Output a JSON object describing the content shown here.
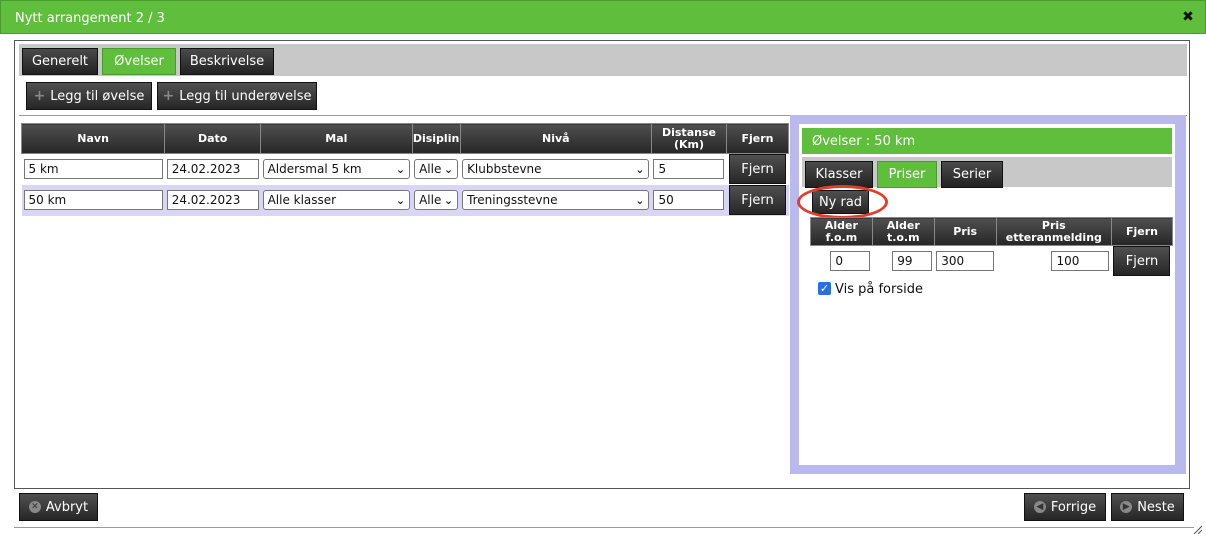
{
  "dialog": {
    "title": "Nytt arrangement 2 / 3",
    "close_icon": "close-icon"
  },
  "tabs": [
    {
      "label": "Generelt",
      "active": false
    },
    {
      "label": "Øvelser",
      "active": true
    },
    {
      "label": "Beskrivelse",
      "active": false
    }
  ],
  "toolbar": {
    "add_exercise": "Legg til øvelse",
    "add_subexercise": "Legg til underøvelse"
  },
  "exercises": {
    "headers": [
      "Navn",
      "Dato",
      "Mal",
      "Disiplin",
      "Nivå",
      "Distanse (Km)",
      "Fjern"
    ],
    "rows": [
      {
        "navn": "5 km",
        "dato": "24.02.2023",
        "mal": "Aldersmal 5 km",
        "disiplin": "Alle",
        "niva": "Klubbstevne",
        "distanse": "5",
        "fjern": "Fjern"
      },
      {
        "navn": "50 km",
        "dato": "24.02.2023",
        "mal": "Alle klasser",
        "disiplin": "Alle",
        "niva": "Treningsstevne",
        "distanse": "50",
        "fjern": "Fjern"
      }
    ]
  },
  "side": {
    "heading": "Øvelser : 50 km",
    "subtabs": [
      {
        "label": "Klasser",
        "active": false
      },
      {
        "label": "Priser",
        "active": true
      },
      {
        "label": "Serier",
        "active": false
      }
    ],
    "new_row": "Ny rad",
    "price_headers": [
      "Alder f.o.m",
      "Alder t.o.m",
      "Pris",
      "Pris etteranmelding",
      "Fjern"
    ],
    "price_rows": [
      {
        "alder_fom": "0",
        "alder_tom": "99",
        "pris": "300",
        "pris_etter": "100",
        "fjern": "Fjern"
      }
    ],
    "show_on_front": {
      "label": "Vis på forside",
      "checked": true
    }
  },
  "footer": {
    "cancel": "Avbryt",
    "previous": "Forrige",
    "next": "Neste"
  },
  "colors": {
    "accent": "#5fbe3c",
    "side_panel": "#b9b8ef",
    "row_alt": "#d7d6f5",
    "highlight_ring": "#e0402a"
  }
}
